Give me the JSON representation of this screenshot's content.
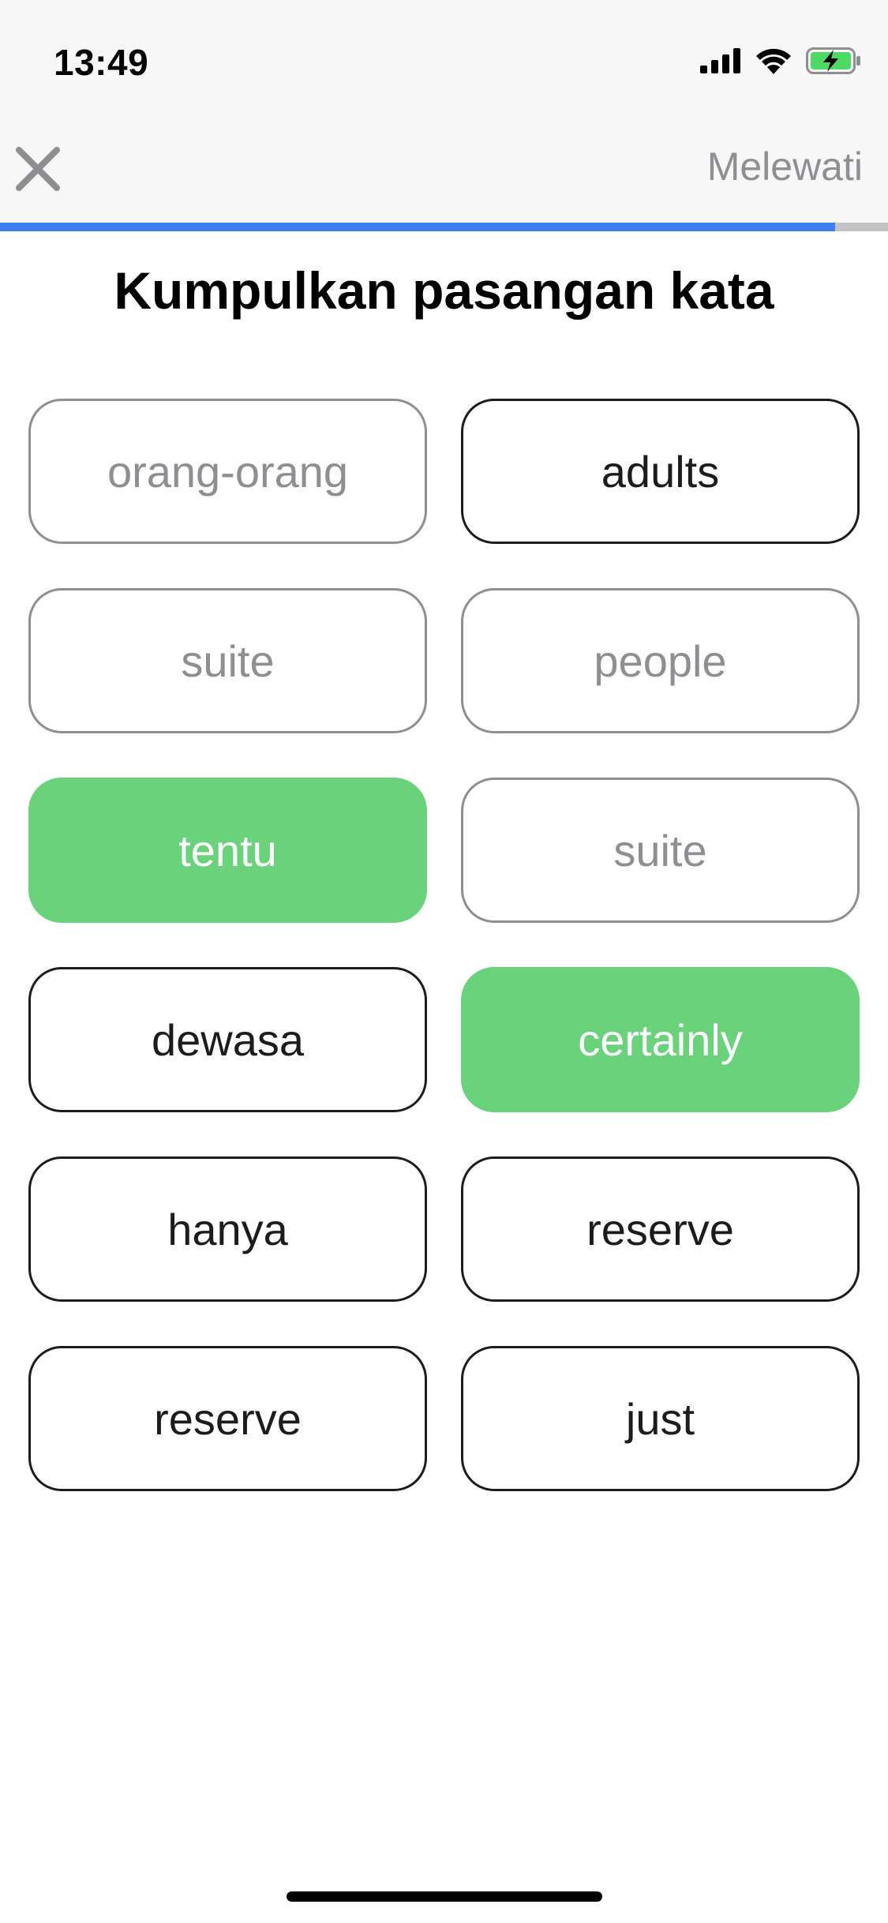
{
  "status_bar": {
    "time": "13:49",
    "icons": [
      "cellular-signal-icon",
      "wifi-icon",
      "battery-charging-icon"
    ],
    "battery_color": "#4cd964"
  },
  "header": {
    "close_icon": "close-icon",
    "skip_label": "Melewati"
  },
  "progress": {
    "fraction": 0.94,
    "fill_color": "#3d7fef",
    "track_color": "#c4c4c4"
  },
  "title": "Kumpulkan pasangan kata",
  "tiles": [
    {
      "label": "orang-orang",
      "state": "matched"
    },
    {
      "label": "adults",
      "state": "active"
    },
    {
      "label": "suite",
      "state": "matched"
    },
    {
      "label": "people",
      "state": "matched"
    },
    {
      "label": "tentu",
      "state": "selected"
    },
    {
      "label": "suite",
      "state": "matched"
    },
    {
      "label": "dewasa",
      "state": "active"
    },
    {
      "label": "certainly",
      "state": "selected"
    },
    {
      "label": "hanya",
      "state": "active"
    },
    {
      "label": "reserve",
      "state": "active"
    },
    {
      "label": "reserve",
      "state": "active"
    },
    {
      "label": "just",
      "state": "active"
    }
  ],
  "colors": {
    "selected": "#69d27a",
    "matched_text": "#8e8e93",
    "active_text": "#1c1c1e"
  }
}
